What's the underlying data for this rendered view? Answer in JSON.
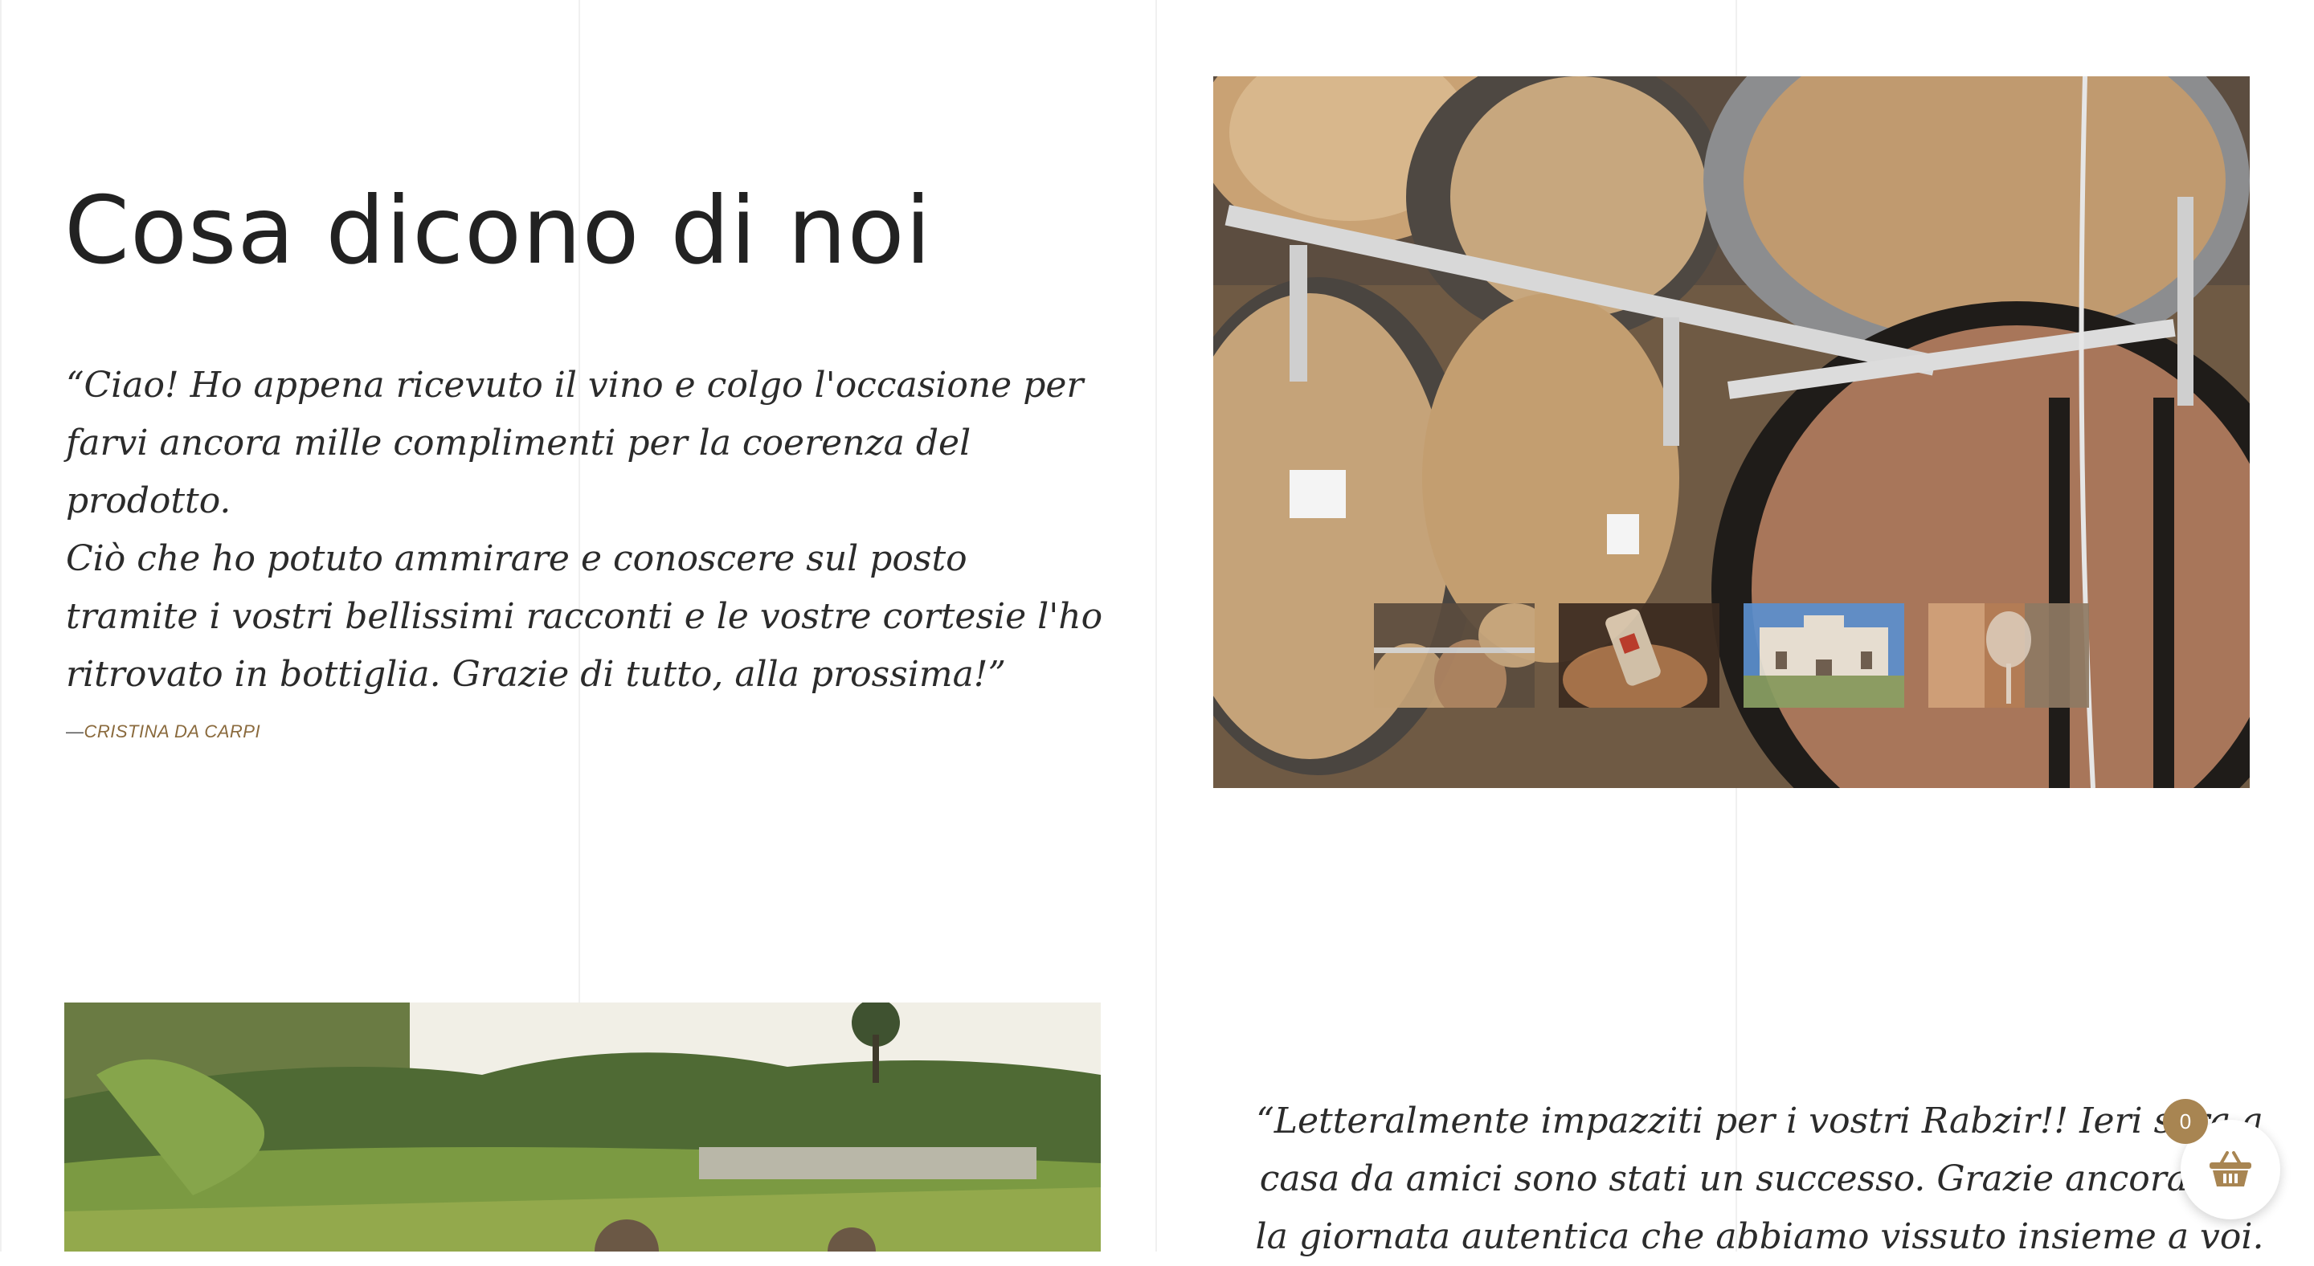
{
  "section": {
    "title": "Cosa dicono di noi"
  },
  "testimonials": [
    {
      "lines": [
        "“Ciao! Ho appena ricevuto il vino e colgo l'occasione per farvi ancora mille complimenti per la coerenza del prodotto.",
        "Ciò che ho potuto ammirare e conoscere sul posto tramite i vostri bellissimi racconti e le vostre cortesie l'ho ritrovato in bottiglia. Grazie di tutto, alla prossima!”"
      ],
      "author_dash": "—",
      "author": "CRISTINA DA CARPI"
    },
    {
      "text": "“Letteralmente impazziti per i vostri Rabzir!! Ieri sera a casa da amici sono stati un successo. Grazie ancora per la giornata autentica che abbiamo vissuto insieme a voi."
    }
  ],
  "gallery": {
    "main_image": "wine-barrels-cellar",
    "thumbnails": [
      "wine-barrels-cellar",
      "wine-bottle-basket",
      "white-villa-facade",
      "wine-glass-tasting"
    ]
  },
  "vineyard_image": "vineyard-harvest",
  "cart": {
    "count": "0",
    "icon": "basket-icon"
  },
  "colors": {
    "text": "#222222",
    "accent": "#a88552",
    "author": "#8a6a3d"
  }
}
